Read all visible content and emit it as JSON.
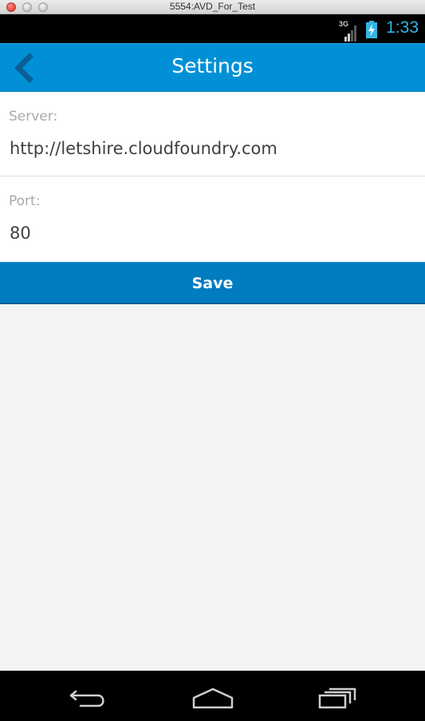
{
  "window": {
    "title": "5554:AVD_For_Test"
  },
  "status_bar": {
    "network": "3G",
    "time": "1:33",
    "accent": "#33b5e5"
  },
  "action_bar": {
    "title": "Settings",
    "back_icon": "chevron-left-icon",
    "color": "#0190d6"
  },
  "form": {
    "server": {
      "label": "Server:",
      "value": "http://letshire.cloudfoundry.com"
    },
    "port": {
      "label": "Port:",
      "value": "80"
    }
  },
  "save_button": {
    "label": "Save",
    "color": "#017cc0"
  },
  "nav_bar": {
    "icons": [
      "back-icon",
      "home-icon",
      "recent-apps-icon"
    ]
  }
}
